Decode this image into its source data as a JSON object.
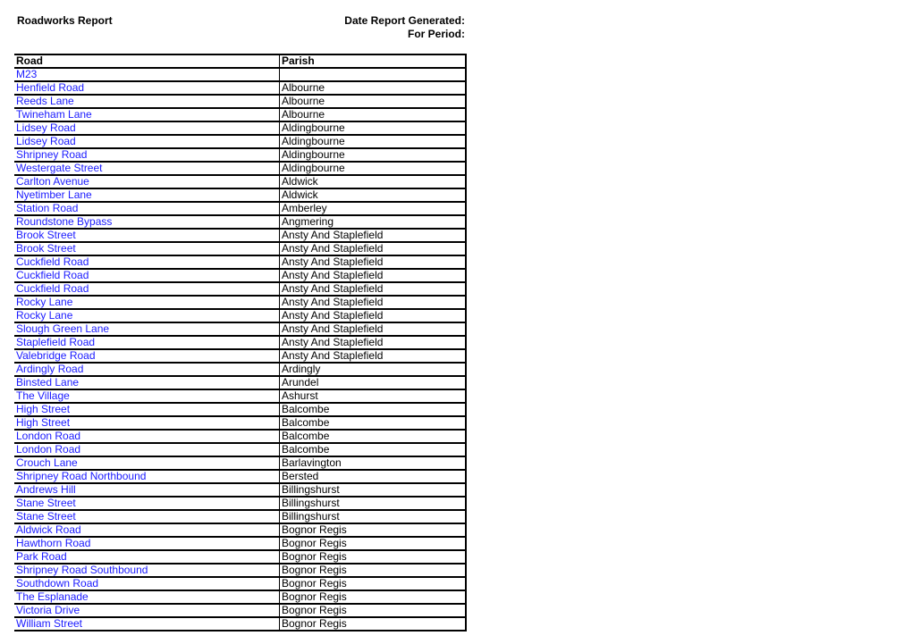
{
  "header": {
    "title": "Roadworks Report",
    "date_generated_label": "Date Report Generated:",
    "period_label": "For Period:"
  },
  "colors": {
    "link": "#1a1aff",
    "text": "#000000",
    "border": "#000000"
  },
  "table": {
    "columns": [
      "Road",
      "Parish"
    ],
    "rows": [
      {
        "road": "M23",
        "parish": ""
      },
      {
        "road": "Henfield Road",
        "parish": "Albourne"
      },
      {
        "road": "Reeds Lane",
        "parish": "Albourne"
      },
      {
        "road": "Twineham Lane",
        "parish": "Albourne"
      },
      {
        "road": "Lidsey Road",
        "parish": "Aldingbourne"
      },
      {
        "road": "Lidsey Road",
        "parish": "Aldingbourne"
      },
      {
        "road": "Shripney Road",
        "parish": "Aldingbourne"
      },
      {
        "road": "Westergate Street",
        "parish": "Aldingbourne"
      },
      {
        "road": "Carlton Avenue",
        "parish": "Aldwick"
      },
      {
        "road": "Nyetimber Lane",
        "parish": "Aldwick"
      },
      {
        "road": "Station Road",
        "parish": "Amberley"
      },
      {
        "road": "Roundstone Bypass",
        "parish": "Angmering"
      },
      {
        "road": "Brook Street",
        "parish": "Ansty And Staplefield"
      },
      {
        "road": "Brook Street",
        "parish": "Ansty And Staplefield"
      },
      {
        "road": "Cuckfield Road",
        "parish": "Ansty And Staplefield"
      },
      {
        "road": "Cuckfield Road",
        "parish": "Ansty And Staplefield"
      },
      {
        "road": "Cuckfield Road",
        "parish": "Ansty And Staplefield"
      },
      {
        "road": "Rocky Lane",
        "parish": "Ansty And Staplefield"
      },
      {
        "road": "Rocky Lane",
        "parish": "Ansty And Staplefield"
      },
      {
        "road": "Slough Green Lane",
        "parish": "Ansty And Staplefield"
      },
      {
        "road": "Staplefield Road",
        "parish": "Ansty And Staplefield"
      },
      {
        "road": "Valebridge Road",
        "parish": "Ansty And Staplefield"
      },
      {
        "road": "Ardingly Road",
        "parish": "Ardingly"
      },
      {
        "road": "Binsted Lane",
        "parish": "Arundel"
      },
      {
        "road": "The Village",
        "parish": "Ashurst"
      },
      {
        "road": "High Street",
        "parish": "Balcombe"
      },
      {
        "road": "High Street",
        "parish": "Balcombe"
      },
      {
        "road": "London Road",
        "parish": "Balcombe"
      },
      {
        "road": "London Road",
        "parish": "Balcombe"
      },
      {
        "road": "Crouch Lane",
        "parish": "Barlavington"
      },
      {
        "road": "Shripney Road Northbound",
        "parish": "Bersted"
      },
      {
        "road": "Andrews Hill",
        "parish": "Billingshurst"
      },
      {
        "road": "Stane Street",
        "parish": "Billingshurst"
      },
      {
        "road": "Stane Street",
        "parish": "Billingshurst"
      },
      {
        "road": "Aldwick Road",
        "parish": "Bognor Regis"
      },
      {
        "road": "Hawthorn Road",
        "parish": "Bognor Regis"
      },
      {
        "road": "Park Road",
        "parish": "Bognor Regis"
      },
      {
        "road": "Shripney Road Southbound",
        "parish": "Bognor Regis"
      },
      {
        "road": "Southdown Road",
        "parish": "Bognor Regis"
      },
      {
        "road": "The Esplanade",
        "parish": "Bognor Regis"
      },
      {
        "road": "Victoria Drive",
        "parish": "Bognor Regis"
      },
      {
        "road": "William Street",
        "parish": "Bognor Regis"
      }
    ]
  }
}
